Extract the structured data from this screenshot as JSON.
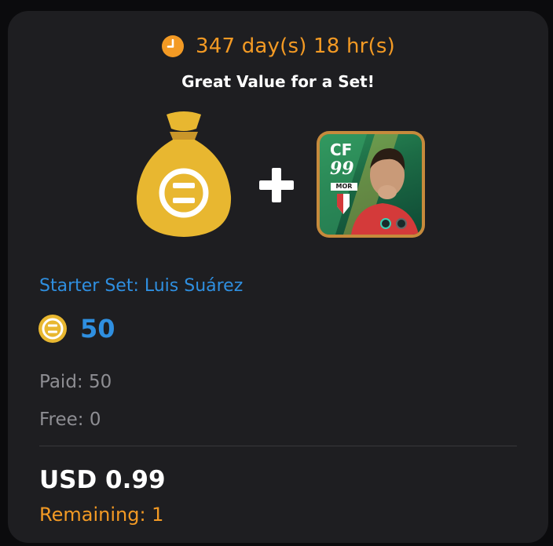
{
  "offer": {
    "timer_text": "347 day(s) 18 hr(s)",
    "subtitle": "Great Value for a Set!",
    "set_name": "Starter Set: Luis Suárez",
    "coin_amount": "50",
    "paid_text": "Paid: 50",
    "free_text": "Free: 0",
    "price_text": "USD 0.99",
    "remaining_text": "Remaining: 1"
  },
  "player_card": {
    "position": "CF",
    "rating": "99",
    "club": "MOR"
  },
  "icons": {
    "timer": "clock-icon",
    "bag": "coin-bag-icon",
    "plus": "plus-icon",
    "coin": "coin-icon"
  },
  "colors": {
    "background": "#1e1e21",
    "accent_orange": "#f39a24",
    "accent_blue": "#2f8fe0",
    "muted_text": "#8e8e93",
    "coin_gold": "#e8b730",
    "card_border": "#c68a3c"
  }
}
